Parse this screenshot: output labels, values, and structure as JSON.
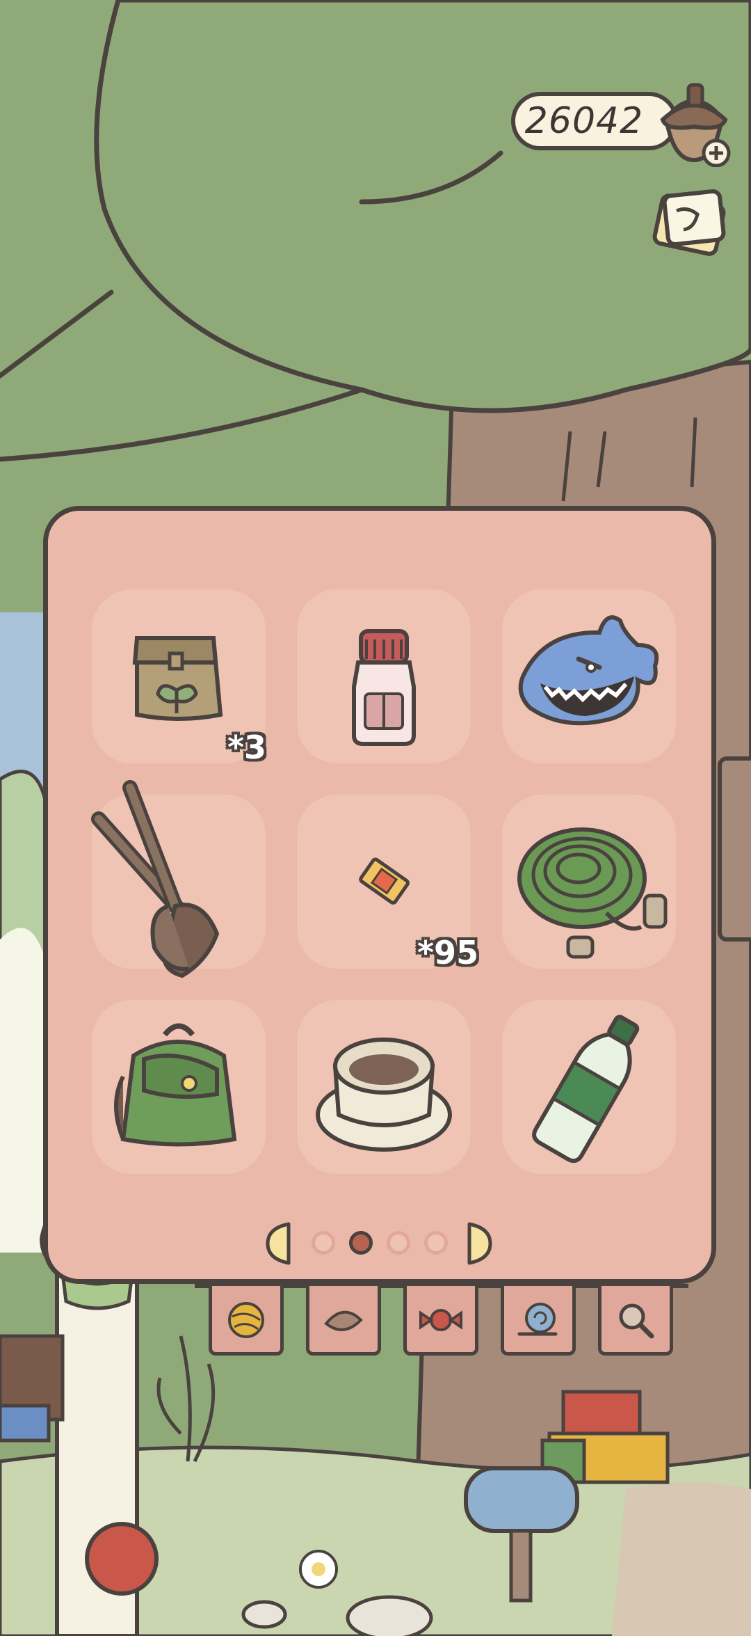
{
  "hud": {
    "clover_count": "26042",
    "acorn_icon": "acorn-plus-icon",
    "notes_icon": "notes-icon"
  },
  "inventory": {
    "items": [
      {
        "name": "seed-bag",
        "quantity": "*3"
      },
      {
        "name": "spice-jar",
        "quantity": ""
      },
      {
        "name": "shark-toy",
        "quantity": ""
      },
      {
        "name": "wooden-spoons",
        "quantity": ""
      },
      {
        "name": "ticket",
        "quantity": "*95"
      },
      {
        "name": "rope",
        "quantity": ""
      },
      {
        "name": "backpack",
        "quantity": ""
      },
      {
        "name": "teacup",
        "quantity": ""
      },
      {
        "name": "water-bottle",
        "quantity": ""
      }
    ],
    "page_count": 4,
    "current_page": 2
  },
  "shop_tabs": [
    "yarn-icon",
    "leaf-icon",
    "candy-icon",
    "snail-icon",
    "magnifier-icon"
  ],
  "colors": {
    "panel": "#ebb9a9",
    "slot": "#f0c4b4",
    "outline": "#4a423f",
    "tree": "#8faa78"
  }
}
